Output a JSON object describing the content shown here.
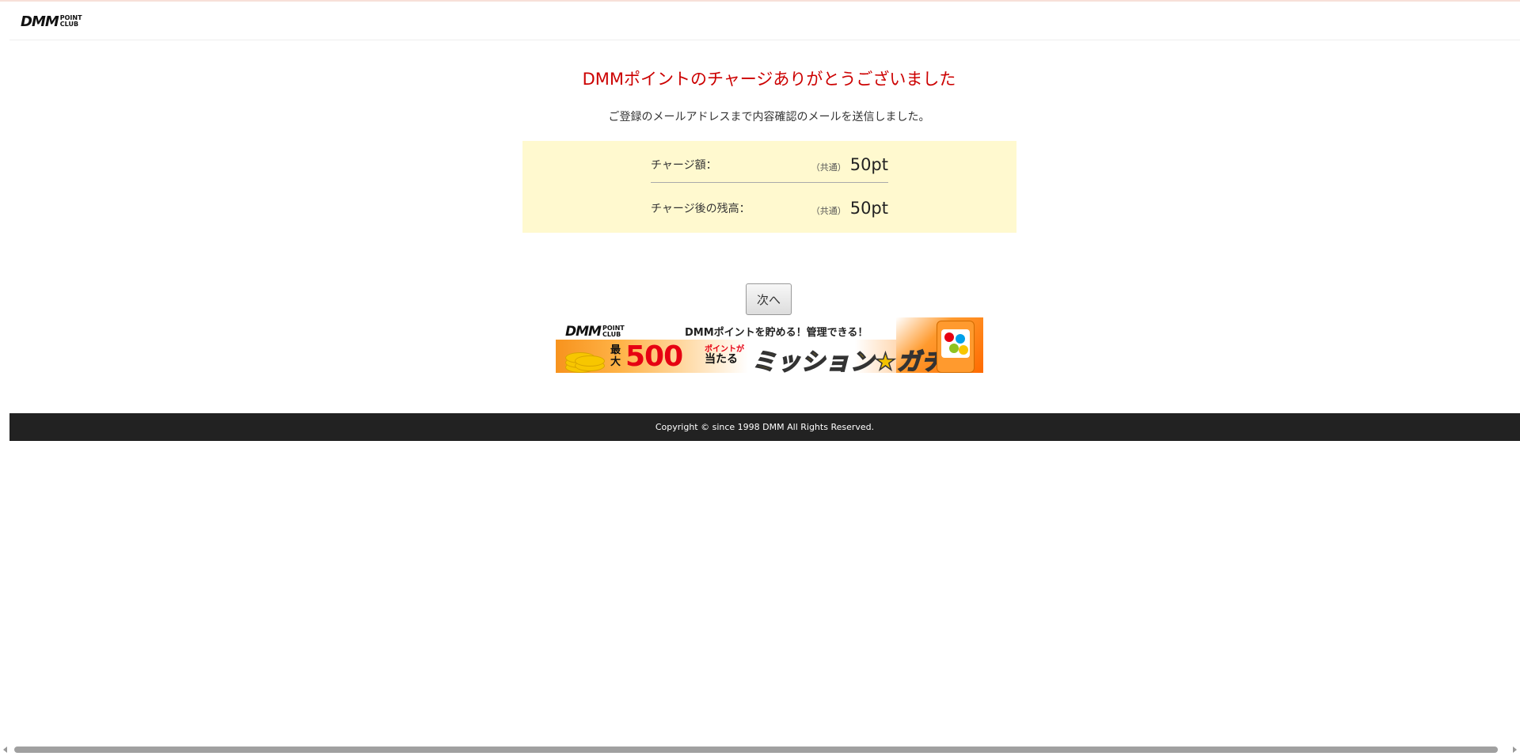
{
  "header": {
    "logo_main": "DMM",
    "logo_sub1": "POINT",
    "logo_sub2": "CLUB"
  },
  "title": "DMMポイントのチャージありがとうございました",
  "message": "ご登録のメールアドレスまで内容確認のメールを送信しました。",
  "summary": {
    "rows": [
      {
        "label": "チャージ額：",
        "type": "（共通）",
        "amount": "50pt"
      },
      {
        "label": "チャージ後の残高：",
        "type": "（共通）",
        "amount": "50pt"
      }
    ]
  },
  "next_button": "次へ",
  "banner": {
    "logo_main": "DMM",
    "logo_sub1": "POINT",
    "logo_sub2": "CLUB",
    "headline": "DMMポイントを貯める！管理できる！",
    "saidai": "最大",
    "amount": "500",
    "point_label": "ポイントが",
    "hit_label": "当たる",
    "gacha": "ミッション★ガチャ"
  },
  "footer": {
    "copyright": "Copyright © since 1998 DMM All Rights Reserved."
  },
  "colors": {
    "title": "#cc0000",
    "summary_bg": "#fff9cf",
    "footer_bg": "#222222"
  }
}
